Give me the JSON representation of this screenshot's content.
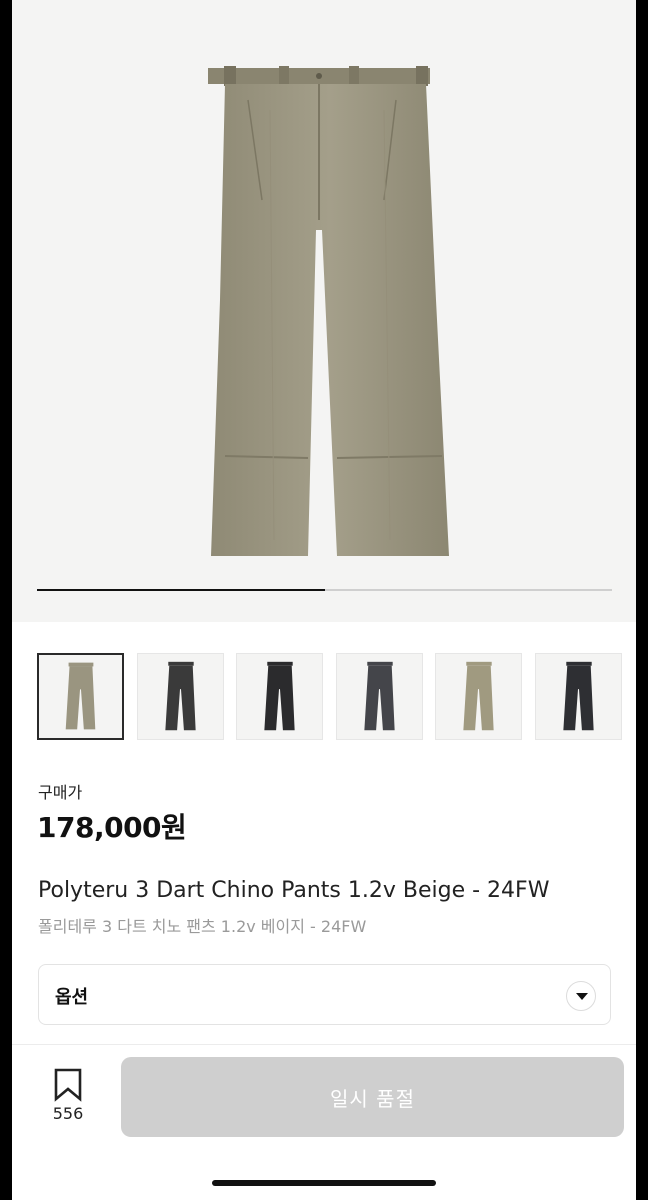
{
  "gallery": {
    "progress": 0.5,
    "thumbnails": [
      {
        "color": "#9a9580",
        "selected": true
      },
      {
        "color": "#3a3a3a",
        "selected": false
      },
      {
        "color": "#2b2b2d",
        "selected": false
      },
      {
        "color": "#44454a",
        "selected": false
      },
      {
        "color": "#a09a80",
        "selected": false
      },
      {
        "color": "#2e2f33",
        "selected": false
      }
    ],
    "main_color": "#9c9782"
  },
  "product": {
    "price_label": "구매가",
    "price": "178,000원",
    "title_en": "Polyteru 3 Dart Chino Pants 1.2v Beige - 24FW",
    "title_ko": "폴리테루 3 다트 치노 팬츠 1.2v 베이지 - 24FW"
  },
  "option": {
    "label": "옵션",
    "icon": "chevron-down-icon"
  },
  "footer": {
    "bookmark_icon": "bookmark-icon",
    "bookmark_count": "556",
    "action_label": "일시 품절"
  }
}
